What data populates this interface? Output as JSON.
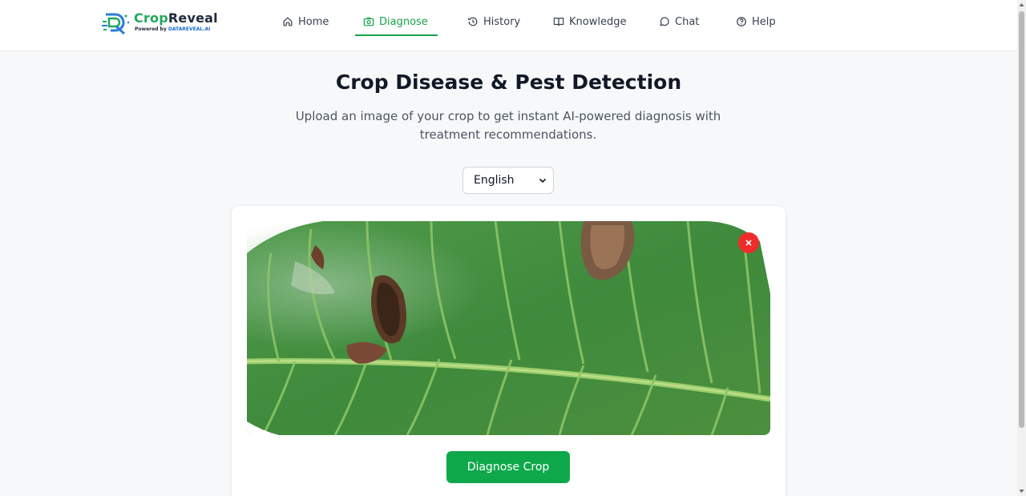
{
  "logo": {
    "name_part1": "Crop",
    "name_part2": "Reveal",
    "powered_by": "Powered by",
    "powered_brand": "DATAREVEAL.AI"
  },
  "nav": {
    "items": [
      {
        "label": "Home",
        "icon": "home-icon"
      },
      {
        "label": "Diagnose",
        "icon": "camera-icon",
        "active": true
      },
      {
        "label": "History",
        "icon": "history-icon"
      },
      {
        "label": "Knowledge",
        "icon": "book-icon"
      },
      {
        "label": "Chat",
        "icon": "chat-icon"
      },
      {
        "label": "Help",
        "icon": "help-icon"
      }
    ]
  },
  "hero": {
    "title": "Crop Disease & Pest Detection",
    "subtitle": "Upload an image of your crop to get instant AI-powered diagnosis with treatment recommendations."
  },
  "language_select": {
    "selected": "English"
  },
  "upload": {
    "image_subject": "diseased crop leaf",
    "remove_icon": "close-icon",
    "diagnose_label": "Diagnose Crop"
  },
  "colors": {
    "accent": "#17a34a",
    "button": "#0ea84b",
    "remove": "#ef2b2b"
  }
}
